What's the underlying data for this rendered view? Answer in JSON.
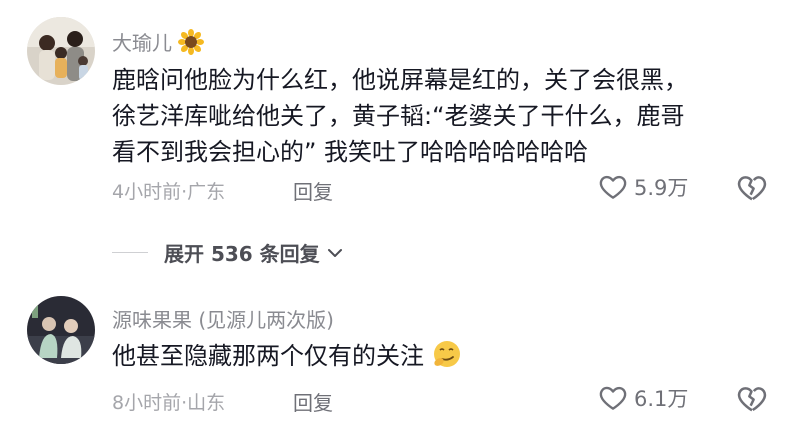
{
  "comments": [
    {
      "username": "大瑜儿",
      "username_emoji": "sunflower-emoji",
      "lines": [
        "鹿晗问他脸为什么红，他说屏幕是红的，关了会很黑，",
        "徐艺洋库呲给他关了，黄子韬:“老婆关了干什么，鹿哥",
        "看不到我会担心的” 我笑吐了哈哈哈哈哈哈哈"
      ],
      "time_location": "4小时前·广东",
      "reply_label": "回复",
      "likes": "5.9万"
    },
    {
      "username": "源味果果 (见源儿两次版)",
      "text": "他甚至隐藏那两个仅有的关注",
      "text_emoji": "smirk-emoji",
      "time_location": "8小时前·山东",
      "reply_label": "回复",
      "likes": "6.1万"
    }
  ],
  "expand_replies": {
    "label": "展开 536 条回复"
  },
  "icons": {
    "like": "heart-outline-icon",
    "dislike": "broken-heart-icon",
    "expand": "chevron-down-icon"
  },
  "colors": {
    "text": "#161823",
    "secondary": "#8a8b91",
    "muted": "#a5a6ab"
  }
}
